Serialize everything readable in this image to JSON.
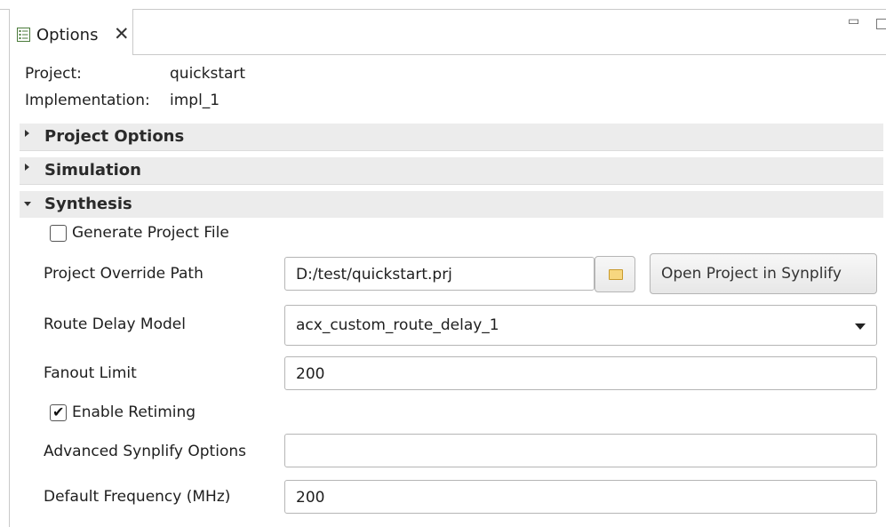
{
  "tab": {
    "label": "Options",
    "close": "✕",
    "icon": "options-list-icon"
  },
  "window": {
    "minimize": "▭"
  },
  "info": {
    "project_label": "Project:",
    "project_value": "quickstart",
    "impl_label": "Implementation:",
    "impl_value": "impl_1"
  },
  "sections": {
    "project_options": "Project Options",
    "simulation": "Simulation",
    "synthesis": "Synthesis"
  },
  "synthesis": {
    "generate_project_file": {
      "label": "Generate Project File",
      "checked": false
    },
    "override_path": {
      "label": "Project Override Path",
      "value": "D:/test/quickstart.prj"
    },
    "open_project_button": "Open Project in Synplify",
    "route_delay": {
      "label": "Route Delay Model",
      "value": "acx_custom_route_delay_1"
    },
    "fanout_limit": {
      "label": "Fanout Limit",
      "value": "200"
    },
    "enable_retiming": {
      "label": "Enable Retiming",
      "checked": true,
      "mark": "✔"
    },
    "advanced_options": {
      "label": "Advanced Synplify Options",
      "value": ""
    },
    "default_frequency": {
      "label": "Default Frequency (MHz)",
      "value": "200"
    }
  },
  "colors": {
    "section_bg": "#ececec",
    "border": "#b5b5b5",
    "folder": "#f7d77f"
  }
}
